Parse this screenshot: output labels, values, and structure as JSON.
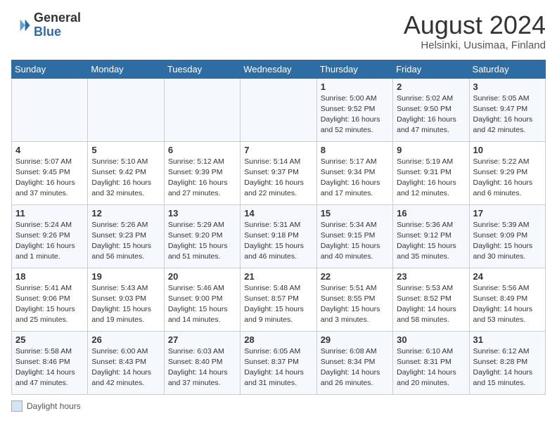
{
  "header": {
    "logo_general": "General",
    "logo_blue": "Blue",
    "month_year": "August 2024",
    "location": "Helsinki, Uusimaa, Finland"
  },
  "weekdays": [
    "Sunday",
    "Monday",
    "Tuesday",
    "Wednesday",
    "Thursday",
    "Friday",
    "Saturday"
  ],
  "legend_label": "Daylight hours",
  "weeks": [
    [
      {
        "day": "",
        "info": ""
      },
      {
        "day": "",
        "info": ""
      },
      {
        "day": "",
        "info": ""
      },
      {
        "day": "",
        "info": ""
      },
      {
        "day": "1",
        "info": "Sunrise: 5:00 AM\nSunset: 9:52 PM\nDaylight: 16 hours\nand 52 minutes."
      },
      {
        "day": "2",
        "info": "Sunrise: 5:02 AM\nSunset: 9:50 PM\nDaylight: 16 hours\nand 47 minutes."
      },
      {
        "day": "3",
        "info": "Sunrise: 5:05 AM\nSunset: 9:47 PM\nDaylight: 16 hours\nand 42 minutes."
      }
    ],
    [
      {
        "day": "4",
        "info": "Sunrise: 5:07 AM\nSunset: 9:45 PM\nDaylight: 16 hours\nand 37 minutes."
      },
      {
        "day": "5",
        "info": "Sunrise: 5:10 AM\nSunset: 9:42 PM\nDaylight: 16 hours\nand 32 minutes."
      },
      {
        "day": "6",
        "info": "Sunrise: 5:12 AM\nSunset: 9:39 PM\nDaylight: 16 hours\nand 27 minutes."
      },
      {
        "day": "7",
        "info": "Sunrise: 5:14 AM\nSunset: 9:37 PM\nDaylight: 16 hours\nand 22 minutes."
      },
      {
        "day": "8",
        "info": "Sunrise: 5:17 AM\nSunset: 9:34 PM\nDaylight: 16 hours\nand 17 minutes."
      },
      {
        "day": "9",
        "info": "Sunrise: 5:19 AM\nSunset: 9:31 PM\nDaylight: 16 hours\nand 12 minutes."
      },
      {
        "day": "10",
        "info": "Sunrise: 5:22 AM\nSunset: 9:29 PM\nDaylight: 16 hours\nand 6 minutes."
      }
    ],
    [
      {
        "day": "11",
        "info": "Sunrise: 5:24 AM\nSunset: 9:26 PM\nDaylight: 16 hours\nand 1 minute."
      },
      {
        "day": "12",
        "info": "Sunrise: 5:26 AM\nSunset: 9:23 PM\nDaylight: 15 hours\nand 56 minutes."
      },
      {
        "day": "13",
        "info": "Sunrise: 5:29 AM\nSunset: 9:20 PM\nDaylight: 15 hours\nand 51 minutes."
      },
      {
        "day": "14",
        "info": "Sunrise: 5:31 AM\nSunset: 9:18 PM\nDaylight: 15 hours\nand 46 minutes."
      },
      {
        "day": "15",
        "info": "Sunrise: 5:34 AM\nSunset: 9:15 PM\nDaylight: 15 hours\nand 40 minutes."
      },
      {
        "day": "16",
        "info": "Sunrise: 5:36 AM\nSunset: 9:12 PM\nDaylight: 15 hours\nand 35 minutes."
      },
      {
        "day": "17",
        "info": "Sunrise: 5:39 AM\nSunset: 9:09 PM\nDaylight: 15 hours\nand 30 minutes."
      }
    ],
    [
      {
        "day": "18",
        "info": "Sunrise: 5:41 AM\nSunset: 9:06 PM\nDaylight: 15 hours\nand 25 minutes."
      },
      {
        "day": "19",
        "info": "Sunrise: 5:43 AM\nSunset: 9:03 PM\nDaylight: 15 hours\nand 19 minutes."
      },
      {
        "day": "20",
        "info": "Sunrise: 5:46 AM\nSunset: 9:00 PM\nDaylight: 15 hours\nand 14 minutes."
      },
      {
        "day": "21",
        "info": "Sunrise: 5:48 AM\nSunset: 8:57 PM\nDaylight: 15 hours\nand 9 minutes."
      },
      {
        "day": "22",
        "info": "Sunrise: 5:51 AM\nSunset: 8:55 PM\nDaylight: 15 hours\nand 3 minutes."
      },
      {
        "day": "23",
        "info": "Sunrise: 5:53 AM\nSunset: 8:52 PM\nDaylight: 14 hours\nand 58 minutes."
      },
      {
        "day": "24",
        "info": "Sunrise: 5:56 AM\nSunset: 8:49 PM\nDaylight: 14 hours\nand 53 minutes."
      }
    ],
    [
      {
        "day": "25",
        "info": "Sunrise: 5:58 AM\nSunset: 8:46 PM\nDaylight: 14 hours\nand 47 minutes."
      },
      {
        "day": "26",
        "info": "Sunrise: 6:00 AM\nSunset: 8:43 PM\nDaylight: 14 hours\nand 42 minutes."
      },
      {
        "day": "27",
        "info": "Sunrise: 6:03 AM\nSunset: 8:40 PM\nDaylight: 14 hours\nand 37 minutes."
      },
      {
        "day": "28",
        "info": "Sunrise: 6:05 AM\nSunset: 8:37 PM\nDaylight: 14 hours\nand 31 minutes."
      },
      {
        "day": "29",
        "info": "Sunrise: 6:08 AM\nSunset: 8:34 PM\nDaylight: 14 hours\nand 26 minutes."
      },
      {
        "day": "30",
        "info": "Sunrise: 6:10 AM\nSunset: 8:31 PM\nDaylight: 14 hours\nand 20 minutes."
      },
      {
        "day": "31",
        "info": "Sunrise: 6:12 AM\nSunset: 8:28 PM\nDaylight: 14 hours\nand 15 minutes."
      }
    ]
  ]
}
